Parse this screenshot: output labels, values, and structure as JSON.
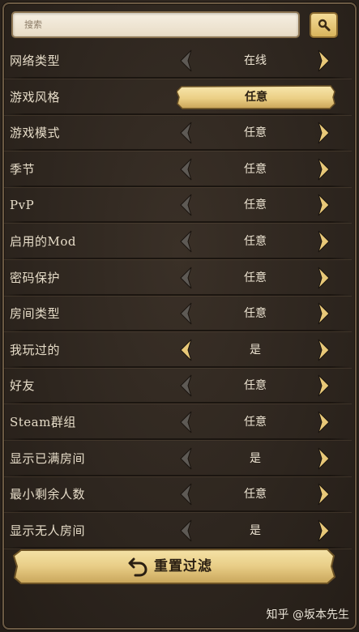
{
  "search": {
    "placeholder": "搜索"
  },
  "rows": [
    {
      "label": "网络类型",
      "value": "在线",
      "highlight": false,
      "left_active": false
    },
    {
      "label": "游戏风格",
      "value": "任意",
      "highlight": true,
      "left_active": false
    },
    {
      "label": "游戏模式",
      "value": "任意",
      "highlight": false,
      "left_active": false
    },
    {
      "label": "季节",
      "value": "任意",
      "highlight": false,
      "left_active": false
    },
    {
      "label": "PvP",
      "value": "任意",
      "highlight": false,
      "left_active": false
    },
    {
      "label": "启用的Mod",
      "value": "任意",
      "highlight": false,
      "left_active": false
    },
    {
      "label": "密码保护",
      "value": "任意",
      "highlight": false,
      "left_active": false
    },
    {
      "label": "房间类型",
      "value": "任意",
      "highlight": false,
      "left_active": false
    },
    {
      "label": "我玩过的",
      "value": "是",
      "highlight": false,
      "left_active": true
    },
    {
      "label": "好友",
      "value": "任意",
      "highlight": false,
      "left_active": false
    },
    {
      "label": "Steam群组",
      "value": "任意",
      "highlight": false,
      "left_active": false
    },
    {
      "label": "显示已满房间",
      "value": "是",
      "highlight": false,
      "left_active": false
    },
    {
      "label": "最小剩余人数",
      "value": "任意",
      "highlight": false,
      "left_active": false
    },
    {
      "label": "显示无人房间",
      "value": "是",
      "highlight": false,
      "left_active": false
    }
  ],
  "reset": {
    "label": "重置过滤"
  },
  "watermark": "知乎 @坂本先生",
  "colors": {
    "background": "#2c241d",
    "label_text": "#e6dcc8",
    "arrow_inactive": "#5e5a55",
    "arrow_active": "#e8c878",
    "button_gold": "#e8cd86"
  }
}
